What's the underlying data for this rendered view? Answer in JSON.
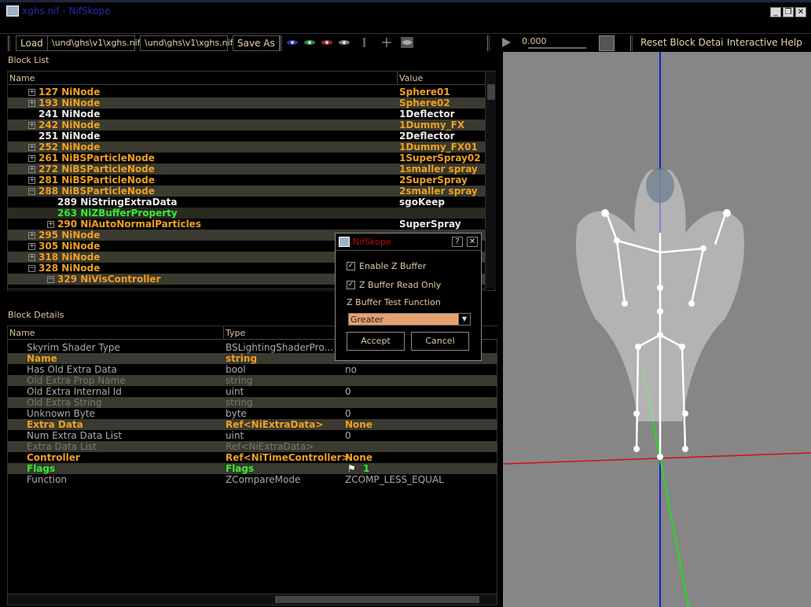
{
  "window": {
    "title": "xghs.nif - NifSkope",
    "min": "_",
    "max": "❐",
    "close": "✕"
  },
  "toolbar": {
    "load": "Load",
    "path1": "\\und\\ghs\\v1\\xghs.nif",
    "path2": "\\und\\ghs\\v1\\xghs.nif",
    "save_as": "Save As",
    "time_value": "0.000",
    "reset": "Reset Block Details",
    "help": "Interactive Help"
  },
  "block_list": {
    "title": "Block List",
    "col_name": "Name",
    "col_value": "Value",
    "rows": [
      {
        "exp": "+",
        "name": "127 NiNode",
        "value": "Sphere01"
      },
      {
        "exp": "+",
        "name": "193 NiNode",
        "value": "Sphere02"
      },
      {
        "exp": "",
        "name": "241 NiNode",
        "value": "1Deflector"
      },
      {
        "exp": "+",
        "name": "242 NiNode",
        "value": "1Dummy_FX"
      },
      {
        "exp": "",
        "name": "251 NiNode",
        "value": "2Deflector"
      },
      {
        "exp": "+",
        "name": "252 NiNode",
        "value": "1Dummy_FX01"
      },
      {
        "exp": "+",
        "name": "261 NiBSParticleNode",
        "value": "1SuperSpray02"
      },
      {
        "exp": "+",
        "name": "272 NiBSParticleNode",
        "value": "1smaller spray"
      },
      {
        "exp": "+",
        "name": "281 NiBSParticleNode",
        "value": "2SuperSpray"
      },
      {
        "exp": "−",
        "name": "288 NiBSParticleNode",
        "value": "2smaller spray"
      },
      {
        "exp": "",
        "name": "289 NiStringExtraData",
        "value": "sgoKeep"
      },
      {
        "exp": "",
        "name": "263 NiZBufferProperty",
        "value": ""
      },
      {
        "exp": "+",
        "name": "290 NiAutoNormalParticles",
        "value": "SuperSpray"
      },
      {
        "exp": "+",
        "name": "295 NiNode",
        "value": ""
      },
      {
        "exp": "+",
        "name": "305 NiNode",
        "value": ""
      },
      {
        "exp": "+",
        "name": "318 NiNode",
        "value": ""
      },
      {
        "exp": "−",
        "name": "328 NiNode",
        "value": ""
      },
      {
        "exp": "−",
        "name": "329 NiVisController",
        "value": ""
      }
    ]
  },
  "block_details": {
    "title": "Block Details",
    "col_name": "Name",
    "col_type": "Type",
    "rows": [
      {
        "name": "Skyrim Shader Type",
        "type": "BSLightingShaderPro...",
        "value": ""
      },
      {
        "name": "Name",
        "type": "string",
        "value": ""
      },
      {
        "name": "Has Old Extra Data",
        "type": "bool",
        "value": "no"
      },
      {
        "name": "Old Extra Prop Name",
        "type": "string",
        "value": ""
      },
      {
        "name": "Old Extra Internal Id",
        "type": "uint",
        "value": "0"
      },
      {
        "name": "Old Extra String",
        "type": "string",
        "value": ""
      },
      {
        "name": "Unknown Byte",
        "type": "byte",
        "value": "0"
      },
      {
        "name": "Extra Data",
        "type": "Ref<NiExtraData>",
        "value": "None"
      },
      {
        "name": "Num Extra Data List",
        "type": "uint",
        "value": "0"
      },
      {
        "name": "Extra Data List",
        "type": "Ref<NiExtraData>",
        "value": ""
      },
      {
        "name": "Controller",
        "type": "Ref<NiTimeController>",
        "value": "None"
      },
      {
        "name": "Flags",
        "type": "Flags",
        "value": "1"
      },
      {
        "name": "Function",
        "type": "ZCompareMode",
        "value": "ZCOMP_LESS_EQUAL"
      }
    ]
  },
  "dialog": {
    "title": "NifSkope",
    "help": "?",
    "close": "✕",
    "enable_z": "Enable Z Buffer",
    "read_only": "Z Buffer Read Only",
    "test_fn_label": "Z Buffer Test Function",
    "test_fn_value": "Greater",
    "accept": "Accept",
    "cancel": "Cancel"
  },
  "colors": {
    "accent": "#f0a020",
    "selected_text": "#33ee33",
    "viewport": "#868686"
  }
}
